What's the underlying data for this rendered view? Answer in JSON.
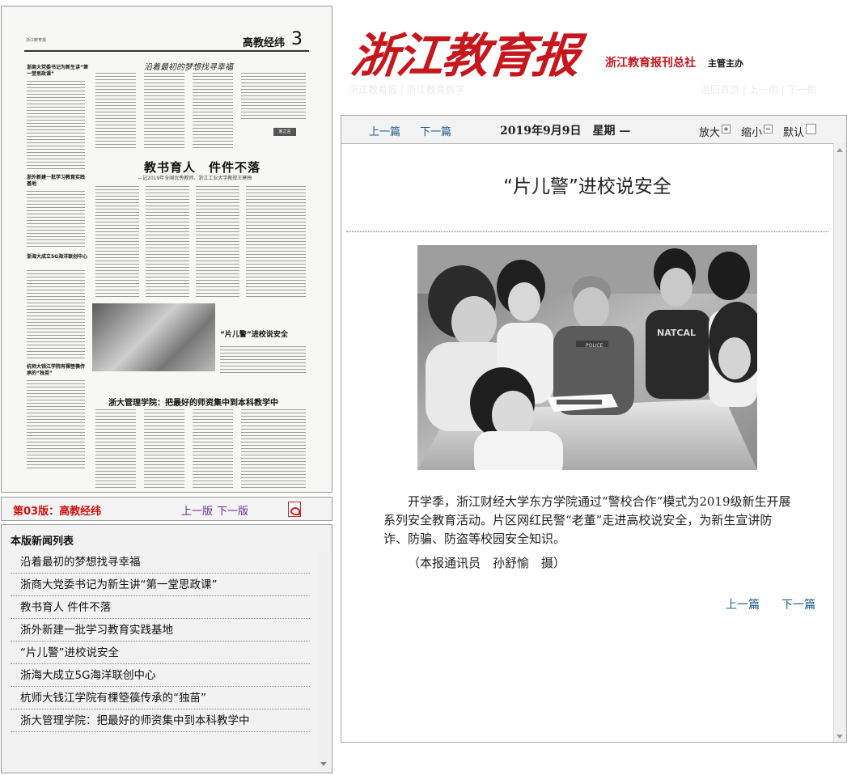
{
  "thumbnail": {
    "header_small": "浙江教育报",
    "section_title": "高教经纬",
    "section_number": "3",
    "slogan": "沿着最初的梦想找寻幸福",
    "banner1": "教书育人　件件不落",
    "banner1_sub": "—记2019年全国优秀教师、浙江工业大学教授王寒梅",
    "side_heads": [
      "浙商大党委书记为新生讲“第一堂思政课”",
      "浙外新建一批学习教育实践基地",
      "浙海大成立5G海洋联创中心",
      "杭师大钱江学院有棵箜篌传承的“独苗”"
    ],
    "stamp": "家之言",
    "photo_caption": "“片儿警”进校说安全",
    "banner2": "浙大管理学院：把最好的师资集中到本科教学中"
  },
  "edition_bar": {
    "label": "第03版：高教经纬",
    "prev": "上一版",
    "next": "下一版",
    "pdf_icon": "pdf-icon"
  },
  "news_list": {
    "title": "本版新闻列表",
    "items": [
      "沿着最初的梦想找寻幸福",
      "浙商大党委书记为新生讲“第一堂思政课”",
      "教书育人 件件不落",
      "浙外新建一批学习教育实践基地",
      "“片儿警”进校说安全",
      "浙海大成立5G海洋联创中心",
      "杭师大钱江学院有棵箜篌传承的“独苗”",
      "浙大管理学院：把最好的师资集中到本科教学中"
    ]
  },
  "masthead": {
    "logo": "浙江教育报",
    "publisher": "浙江教育报刊总社",
    "supervisor": "主管主办",
    "nav_left": "浙江教育报 | 浙江教育数字",
    "nav_right": "返回首页 | 上一期 | 下一期"
  },
  "toolbar": {
    "prev": "上一篇",
    "next": "下一篇",
    "date": "2019年9月9日　星期 —",
    "enlarge": "放大",
    "shrink": "缩小",
    "default": "默认"
  },
  "article": {
    "title": "“片儿警”进校说安全",
    "body": "开学季，浙江财经大学东方学院通过“警校合作”模式为2019级新生开展系列安全教育活动。片区网红民警“老董”走进高校说安全，为新生宣讲防诈、防骗、防盗等校园安全知识。",
    "credit": "（本报通讯员　孙舒愉　摄）",
    "bottom_prev": "上一篇",
    "bottom_next": "下一篇",
    "photo_tshirt_text": "NATCAL",
    "photo_badge_text": "POLICE"
  },
  "colors": {
    "brand_red": "#c8161d",
    "edition_red": "#d01010",
    "link_blue": "#1a5c8c",
    "page_link_purple": "#6b2d91"
  }
}
